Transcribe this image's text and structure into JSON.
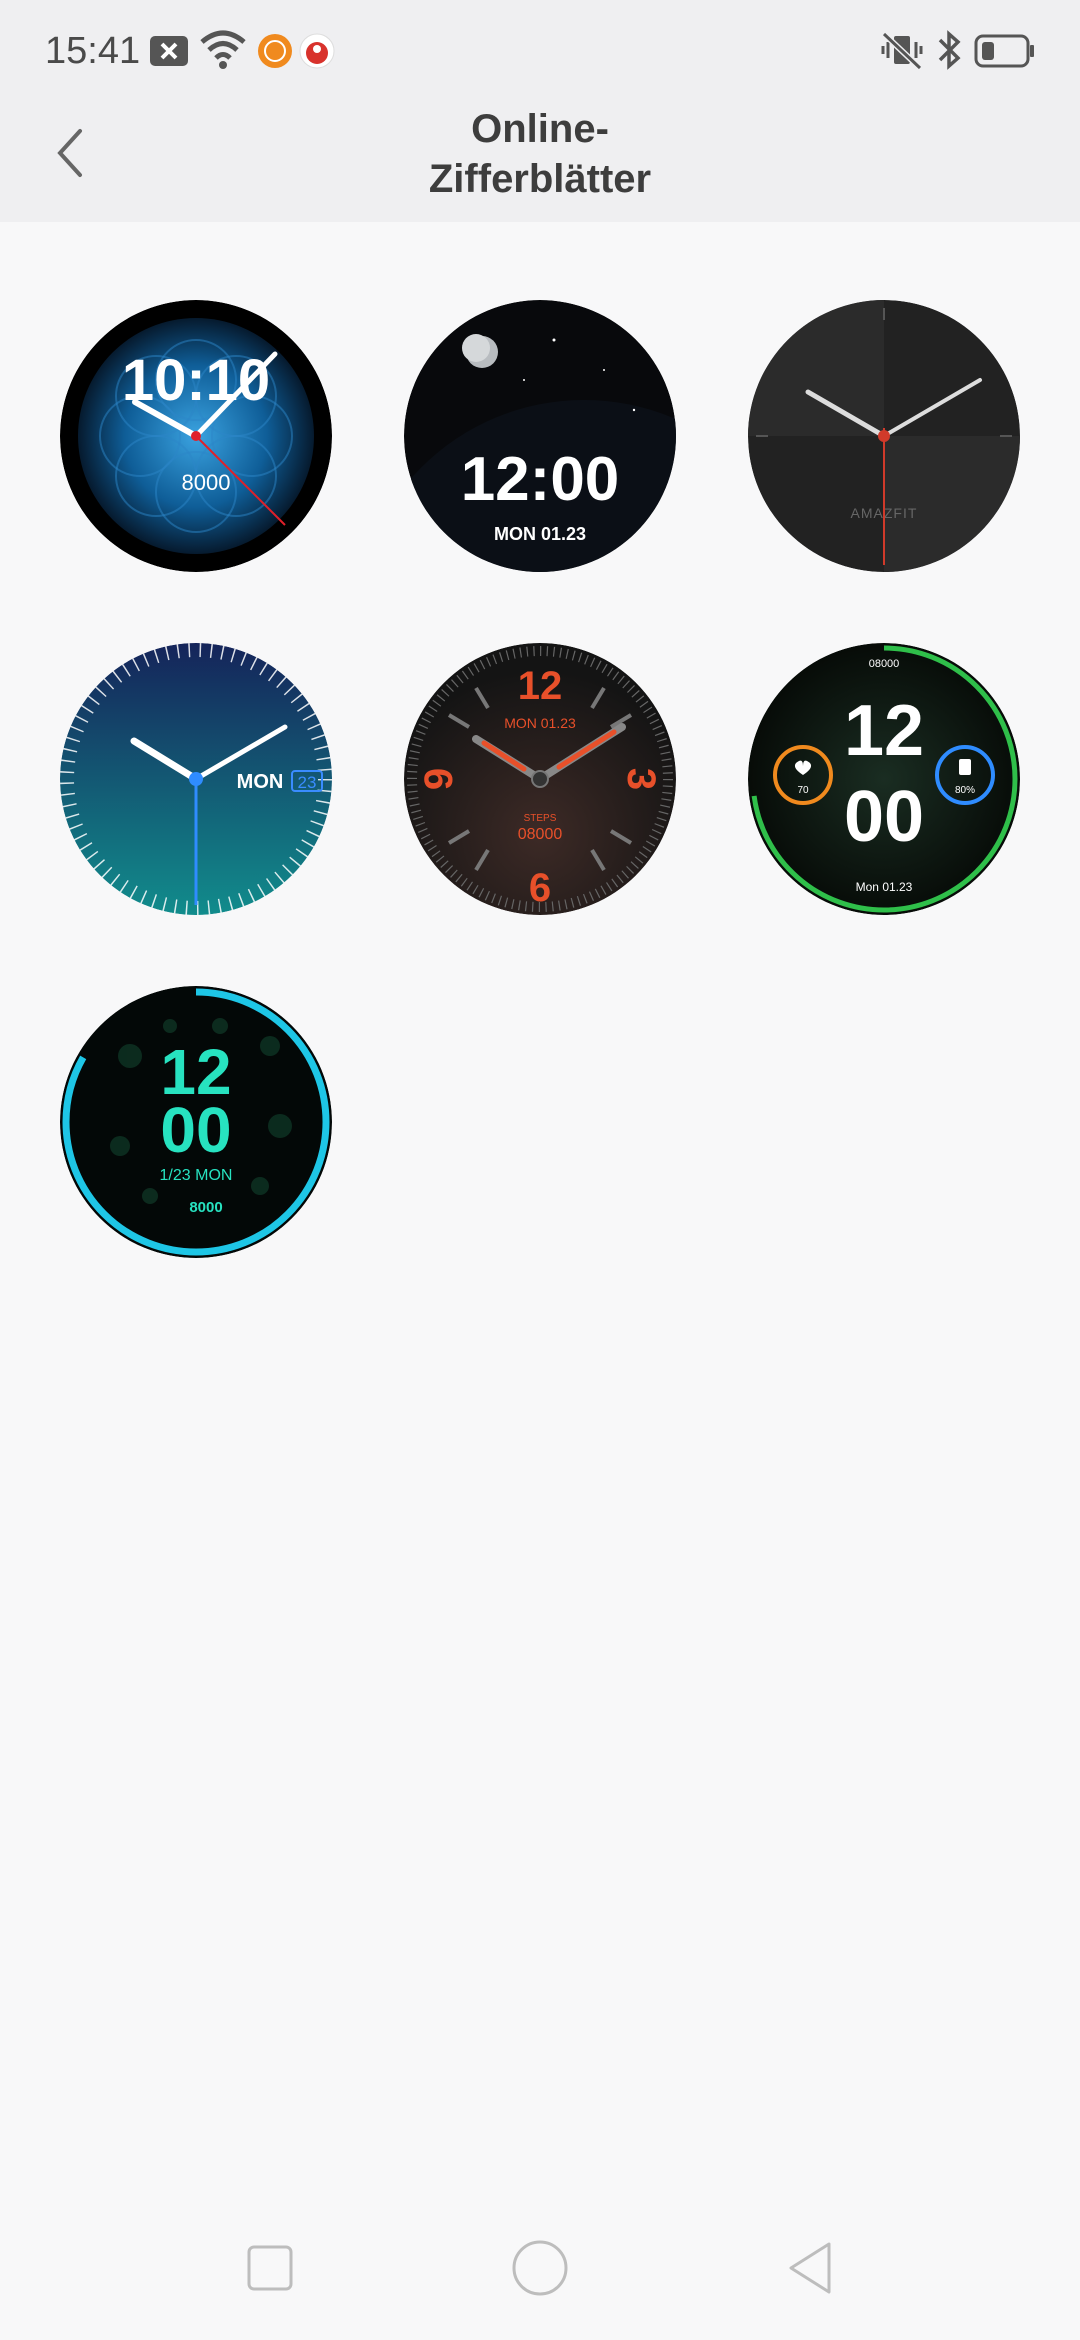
{
  "status_bar": {
    "time": "15:41",
    "left_icons": [
      "close-notification-icon",
      "wifi-icon",
      "app-badge-icon",
      "app-badge-icon"
    ],
    "right_icons": [
      "vibrate-off-icon",
      "bluetooth-icon",
      "battery-icon"
    ]
  },
  "header": {
    "title_line1": "Online-",
    "title_line2": "Zifferblätter",
    "back_icon": "chevron-left-icon"
  },
  "watch_faces": [
    {
      "id": "face-1",
      "line1": "10:10",
      "line2": "8000"
    },
    {
      "id": "face-2",
      "line1": "12:00",
      "line2": "MON  01.23"
    },
    {
      "id": "face-3",
      "line1": "AMAZFIT"
    },
    {
      "id": "face-4",
      "line1": "MON",
      "line2": "23"
    },
    {
      "id": "face-5",
      "line1": "12",
      "line2": "MON 01.23",
      "line3": "STEPS",
      "line4": "08000",
      "line5": "9",
      "line6": "3",
      "line7": "6"
    },
    {
      "id": "face-6",
      "line1": "08000",
      "line2": "12",
      "line3": "00",
      "line4": "70",
      "line5": "80%",
      "line6": "Mon   01.23"
    },
    {
      "id": "face-7",
      "line1": "12",
      "line2": "00",
      "line3": "1/23   MON",
      "line4": "8000"
    }
  ],
  "nav_bar": {
    "items": [
      "recents-square-icon",
      "home-circle-icon",
      "back-triangle-icon"
    ]
  },
  "colors": {
    "header_bg": "#efeff1",
    "page_bg": "#f8f8f9",
    "accent_red": "#e8502a",
    "accent_cyan": "#1ec6e6",
    "accent_green": "#2fbf4a"
  }
}
